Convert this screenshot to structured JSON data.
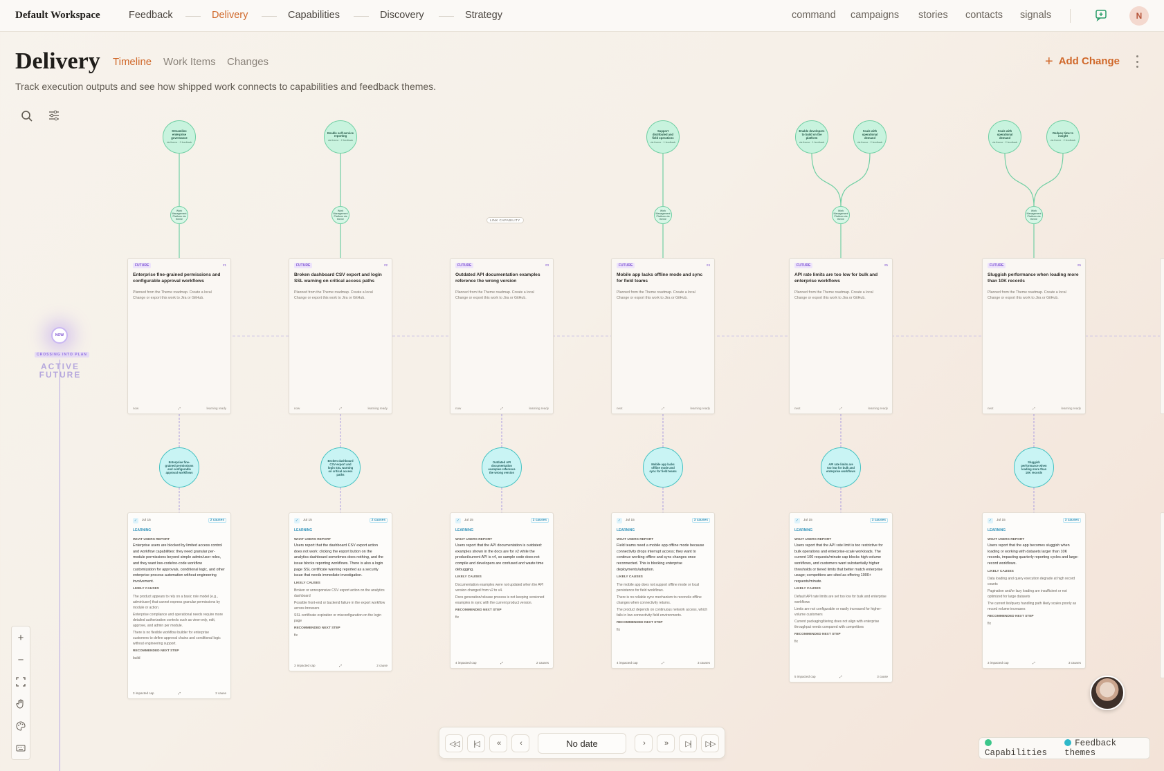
{
  "nav": {
    "workspace": "Default Workspace",
    "items": [
      "Feedback",
      "Delivery",
      "Capabilities",
      "Discovery",
      "Strategy"
    ],
    "active": "Delivery",
    "right": [
      "command",
      "campaigns",
      "stories",
      "contacts",
      "signals"
    ],
    "avatar": "N"
  },
  "header": {
    "title": "Delivery",
    "tabs": [
      "Timeline",
      "Work Items",
      "Changes"
    ],
    "active_tab": "Timeline",
    "subtitle": "Track execution outputs and see how shipped work connects to capabilities and feedback themes.",
    "add_button": "Add Change"
  },
  "now": {
    "label": "NOW",
    "crossing": "CROSSING INTO PLAN",
    "state_a": "ACTIVE",
    "state_b": "FUTURE"
  },
  "link_capability": "LINK CAPABILITY",
  "columns": [
    {
      "capabilities": [
        {
          "title": "Streamline enterprise governance",
          "sub": "via theme · 2 feedback"
        }
      ],
      "small_node": "Work Management Platform via theme",
      "card": {
        "badge": "FUTURE",
        "num": "#1",
        "title": "Enterprise fine-grained permissions and configurable approval workflows",
        "desc": "Planned from the Theme roadmap. Create a local Change or export this work to Jira or GitHub.",
        "f_left": "now",
        "f_right": "learning ready"
      },
      "theme": "Enterprise fine-grained permissions and configurable approval workflows",
      "learning": {
        "date": "Jul 15",
        "causes": "2 causes",
        "label": "LEARNING",
        "h1": "WHAT USERS REPORT",
        "report": "Enterprise users are blocked by limited access control and workflow capabilities: they need granular per-module permissions beyond simple admin/user roles, and they want low-code/no-code workflow customization for approvals, conditional logic, and other enterprise process automation without engineering involvement.",
        "h2": "LIKELY CAUSES",
        "cause_list": [
          "The product appears to rely on a basic role model (e.g., admin/user) that cannot express granular permissions by module or action.",
          "Enterprise compliance and operational needs require more detailed authorization controls such as view-only, edit, approve, and admin per module.",
          "There is no flexible workflow builder for enterprise customers to define approval chains and conditional logic without engineering support."
        ],
        "h3": "RECOMMENDED NEXT STEP",
        "next": "build",
        "f_left": "3 impacted cap",
        "f_right": "2 cause"
      }
    },
    {
      "capabilities": [
        {
          "title": "Enable self-service reporting",
          "sub": "via theme · 2 feedback"
        }
      ],
      "small_node": "Work Management Platform via theme",
      "card": {
        "badge": "FUTURE",
        "num": "#2",
        "title": "Broken dashboard CSV export and login SSL warning on critical access paths",
        "desc": "Planned from the Theme roadmap. Create a local Change or export this work to Jira or GitHub.",
        "f_left": "now",
        "f_right": "learning ready"
      },
      "theme": "Broken dashboard CSV export and login SSL warning on critical access paths",
      "learning": {
        "date": "Jul 15",
        "causes": "2 causes",
        "label": "LEARNING",
        "h1": "WHAT USERS REPORT",
        "report": "Users report that the dashboard CSV export action does not work: clicking the export button on the analytics dashboard sometimes does nothing, and the issue blocks reporting workflows. There is also a login page SSL certificate warning reported as a security issue that needs immediate investigation.",
        "h2": "LIKELY CAUSES",
        "cause_list": [
          "Broken or unresponsive CSV export action on the analytics dashboard",
          "Possible front-end or backend failure in the export workflow across browsers",
          "SSL certificate expiration or misconfiguration on the login page"
        ],
        "h3": "RECOMMENDED NEXT STEP",
        "next": "fix",
        "f_left": "3 impacted cap",
        "f_right": "2 cause"
      }
    },
    {
      "capabilities": [],
      "small_node": "",
      "card": {
        "badge": "FUTURE",
        "num": "#3",
        "title": "Outdated API documentation examples reference the wrong version",
        "desc": "Planned from the Theme roadmap. Create a local Change or export this work to Jira or GitHub.",
        "f_left": "now",
        "f_right": "learning ready"
      },
      "theme": "Outdated API documentation examples reference the wrong version",
      "learning": {
        "date": "Jul 15",
        "causes": "2 causes",
        "label": "LEARNING",
        "h1": "WHAT USERS REPORT",
        "report": "Users report that the API documentation is outdated: examples shown in the docs are for v2 while the product/current API is v4, so sample code does not compile and developers are confused and waste time debugging.",
        "h2": "LIKELY CAUSES",
        "cause_list": [
          "Documentation examples were not updated when the API version changed from v2 to v4.",
          "Docs generation/release process is not keeping versioned examples in sync with the current product version."
        ],
        "h3": "RECOMMENDED NEXT STEP",
        "next": "fix",
        "f_left": "4 impacted cap",
        "f_right": "2 causes"
      }
    },
    {
      "capabilities": [
        {
          "title": "Support distributed and field operations",
          "sub": "via theme · 1 feedback"
        }
      ],
      "small_node": "Work Management Platform via theme",
      "card": {
        "badge": "FUTURE",
        "num": "#4",
        "title": "Mobile app lacks offline mode and sync for field teams",
        "desc": "Planned from the Theme roadmap. Create a local Change or export this work to Jira or GitHub.",
        "f_left": "next",
        "f_right": "learning ready"
      },
      "theme": "Mobile app lacks offline mode and sync for field teams",
      "learning": {
        "date": "Jul 15",
        "causes": "3 causes",
        "label": "LEARNING",
        "h1": "WHAT USERS REPORT",
        "report": "Field teams need a mobile app offline mode because connectivity drops interrupt access; they want to continue working offline and sync changes once reconnected. This is blocking enterprise deployments/adoption.",
        "h2": "LIKELY CAUSES",
        "cause_list": [
          "The mobile app does not support offline mode or local persistence for field workflows.",
          "There is no reliable sync mechanism to reconcile offline changes when connectivity returns.",
          "The product depends on continuous network access, which fails in low-connectivity field environments."
        ],
        "h3": "RECOMMENDED NEXT STEP",
        "next": "fix",
        "f_left": "4 impacted cap",
        "f_right": "3 causes"
      }
    },
    {
      "capabilities": [
        {
          "title": "Enable developers to build on the platform",
          "sub": "via theme · 1 feedback"
        },
        {
          "title": "Scale with operational demand",
          "sub": "via theme · 2 feedback"
        }
      ],
      "small_node": "Work Management Platform via theme",
      "card": {
        "badge": "FUTURE",
        "num": "#5",
        "title": "API rate limits are too low for bulk and enterprise workflows",
        "desc": "Planned from the Theme roadmap. Create a local Change or export this work to Jira or GitHub.",
        "f_left": "next",
        "f_right": "learning ready"
      },
      "theme": "API rate limits are too low for bulk and enterprise workflows",
      "learning": {
        "date": "Jul 15",
        "causes": "3 causes",
        "label": "LEARNING",
        "h1": "WHAT USERS REPORT",
        "report": "Users report that the API rate limit is too restrictive for bulk operations and enterprise-scale workloads. The current 100 requests/minute cap blocks high-volume workflows, and customers want substantially higher thresholds or tiered limits that better match enterprise usage; competitors are cited as offering 1000+ requests/minute.",
        "h2": "LIKELY CAUSES",
        "cause_list": [
          "Default API rate limits are set too low for bulk and enterprise workflows",
          "Limits are not configurable or easily increased for higher-volume customers",
          "Current packaging/tiering does not align with enterprise throughput needs compared with competitors"
        ],
        "h3": "RECOMMENDED NEXT STEP",
        "next": "fix",
        "f_left": "5 impacted cap",
        "f_right": "3 cause"
      }
    },
    {
      "capabilities": [
        {
          "title": "Scale with operational demand",
          "sub": "via theme · 2 feedback"
        },
        {
          "title": "Reduce time to insight",
          "sub": "via theme · 2 feedback"
        }
      ],
      "small_node": "Work Management Platform via theme",
      "card": {
        "badge": "FUTURE",
        "num": "#6",
        "title": "Sluggish performance when loading more than 10K records",
        "desc": "Planned from the Theme roadmap. Create a local Change or export this work to Jira or GitHub.",
        "f_left": "next",
        "f_right": "learning ready"
      },
      "theme": "Sluggish performance when loading more than 10K records",
      "learning": {
        "date": "Jul 15",
        "causes": "3 causes",
        "label": "LEARNING",
        "h1": "WHAT USERS REPORT",
        "report": "Users report that the app becomes sluggish when loading or working with datasets larger than 10K records, impacting quarterly reporting cycles and large-record workflows.",
        "h2": "LIKELY CAUSES",
        "cause_list": [
          "Data loading and query execution degrade at high record counts",
          "Pagination and/or lazy loading are insufficient or not optimized for large datasets",
          "The current list/query handling path likely scales poorly as record volume increases"
        ],
        "h3": "RECOMMENDED NEXT STEP",
        "next": "fix",
        "f_left": "3 impacted cap",
        "f_right": "3 causes"
      }
    }
  ],
  "pager": {
    "date": "No date"
  },
  "legend": {
    "capabilities": "Capabilities",
    "feedback": "Feedback themes",
    "cap_color": "#3cc68a",
    "fb_color": "#2fb8c9"
  }
}
